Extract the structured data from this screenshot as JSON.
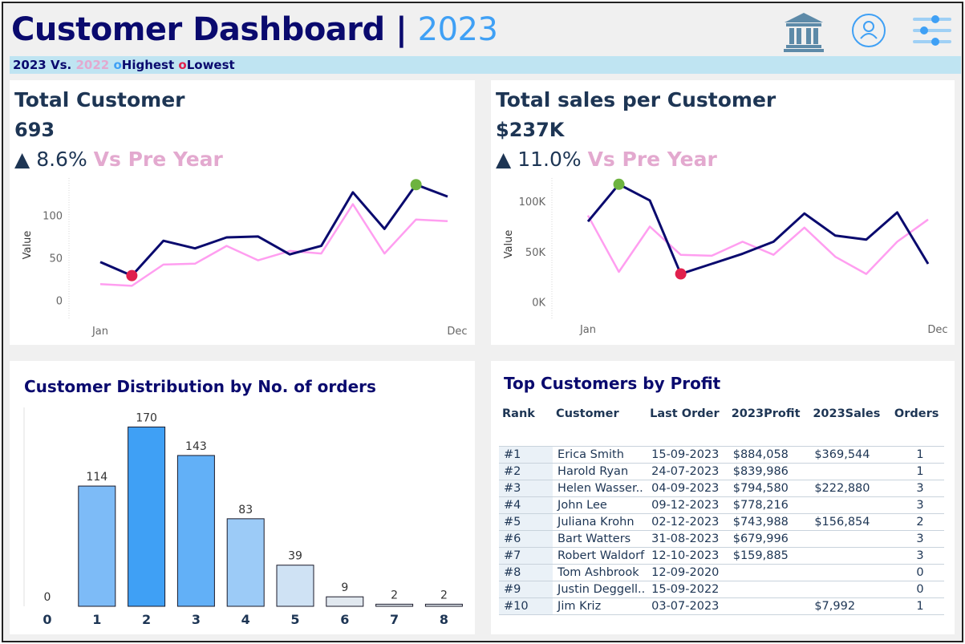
{
  "header": {
    "title": "Customer Dashboard",
    "separator": "|",
    "year": "2023",
    "icons": [
      "bank-icon",
      "user-icon",
      "sliders-icon"
    ]
  },
  "legend": {
    "current": "2023",
    "vs": "Vs.",
    "previous": "2022",
    "highest_marker": "o",
    "highest": "Highest",
    "lowest_marker": "o",
    "lowest": "Lowest"
  },
  "colors": {
    "current_line": "#0a0a6e",
    "previous_line": "#ff9ef0",
    "highest_dot": "#6db33f",
    "lowest_dot": "#e0204d",
    "accent": "#3fa0f5",
    "pink_text": "#e3a9cf"
  },
  "kpi_customers": {
    "title": "Total Customer",
    "value": "693",
    "arrow": "▲",
    "delta": "8.6%",
    "vs_label": "Vs Pre Year"
  },
  "kpi_sales": {
    "title": "Total sales per Customer",
    "value": "$237K",
    "arrow": "▲",
    "delta": "11.0%",
    "vs_label": "Vs Pre Year"
  },
  "distribution": {
    "title": "Customer Distribution by No. of orders"
  },
  "top_customers": {
    "title": "Top Customers by Profit",
    "columns": [
      "Rank",
      "Customer",
      "Last Order",
      "2023Profit",
      "2023Sales",
      "Orders"
    ],
    "rows": [
      [
        "#1",
        "Erica Smith",
        "15-09-2023",
        "$884,058",
        "$369,544",
        "1"
      ],
      [
        "#2",
        "Harold Ryan",
        "24-07-2023",
        "$839,986",
        "",
        "1"
      ],
      [
        "#3",
        "Helen Wasser..",
        "04-09-2023",
        "$794,580",
        "$222,880",
        "3"
      ],
      [
        "#4",
        "John Lee",
        "09-12-2023",
        "$778,216",
        "",
        "3"
      ],
      [
        "#5",
        "Juliana Krohn",
        "02-12-2023",
        "$743,988",
        "$156,854",
        "2"
      ],
      [
        "#6",
        "Bart Watters",
        "31-08-2023",
        "$679,996",
        "",
        "3"
      ],
      [
        "#7",
        "Robert Waldorf",
        "12-10-2023",
        "$159,885",
        "",
        "3"
      ],
      [
        "#8",
        "Tom Ashbrook",
        "12-09-2020",
        "",
        "",
        "0"
      ],
      [
        "#9",
        "Justin Deggell..",
        "15-09-2022",
        "",
        "",
        "0"
      ],
      [
        "#10",
        "Jim Kriz",
        "03-07-2023",
        "",
        "$7,992",
        "1"
      ]
    ]
  },
  "chart_data": [
    {
      "id": "customers",
      "type": "line",
      "ylabel": "Value",
      "xlabel": "",
      "x": [
        "Jan",
        "Feb",
        "Mar",
        "Apr",
        "May",
        "Jun",
        "Jul",
        "Aug",
        "Sep",
        "Oct",
        "Nov",
        "Dec"
      ],
      "x_tick_labels": [
        "Jan",
        "Dec"
      ],
      "y_ticks": [
        0,
        50,
        100
      ],
      "y_tick_labels": [
        "0",
        "50",
        "100"
      ],
      "ylim": [
        -10,
        140
      ],
      "series": [
        {
          "values": [
            45,
            29,
            70,
            61,
            74,
            75,
            54,
            64,
            127,
            84,
            136,
            122
          ]
        },
        {
          "values": [
            19,
            17,
            42,
            43,
            64,
            47,
            58,
            55,
            113,
            55,
            95,
            93
          ]
        }
      ],
      "highest": {
        "x": "Nov",
        "value": 136
      },
      "lowest": {
        "x": "Feb",
        "value": 29
      },
      "grid": false
    },
    {
      "id": "sales",
      "type": "line",
      "ylabel": "Value",
      "xlabel": "",
      "x": [
        "Jan",
        "Feb",
        "Mar",
        "Apr",
        "May",
        "Jun",
        "Jul",
        "Aug",
        "Sep",
        "Oct",
        "Nov",
        "Dec"
      ],
      "x_tick_labels": [
        "Jan",
        "Dec"
      ],
      "y_ticks": [
        0,
        50000,
        100000
      ],
      "y_tick_labels": [
        "0K",
        "50K",
        "100K"
      ],
      "ylim": [
        -5000,
        120000
      ],
      "series": [
        {
          "values": [
            80000,
            117000,
            101000,
            28000,
            38000,
            48000,
            60000,
            88000,
            66000,
            62000,
            89000,
            38000
          ]
        },
        {
          "values": [
            86000,
            30000,
            75000,
            47000,
            46000,
            60000,
            47000,
            74000,
            45000,
            28000,
            60000,
            82000
          ]
        }
      ],
      "highest": {
        "x": "Feb",
        "value": 117000
      },
      "lowest": {
        "x": "Apr",
        "value": 28000
      },
      "grid": false
    },
    {
      "id": "distribution",
      "type": "bar",
      "title": "Customer Distribution by No. of orders",
      "categories": [
        "0",
        "1",
        "2",
        "3",
        "4",
        "5",
        "6",
        "7",
        "8"
      ],
      "values": [
        0,
        114,
        170,
        143,
        83,
        39,
        9,
        2,
        2
      ],
      "ylim": [
        0,
        180
      ],
      "colors": [
        "#c9dff4",
        "#7dbbf7",
        "#3fa0f5",
        "#62b0f7",
        "#9ccbf7",
        "#cfe2f4",
        "#e1e8ef",
        "#e1e8ef",
        "#e1e8ef"
      ],
      "grid": false
    }
  ]
}
